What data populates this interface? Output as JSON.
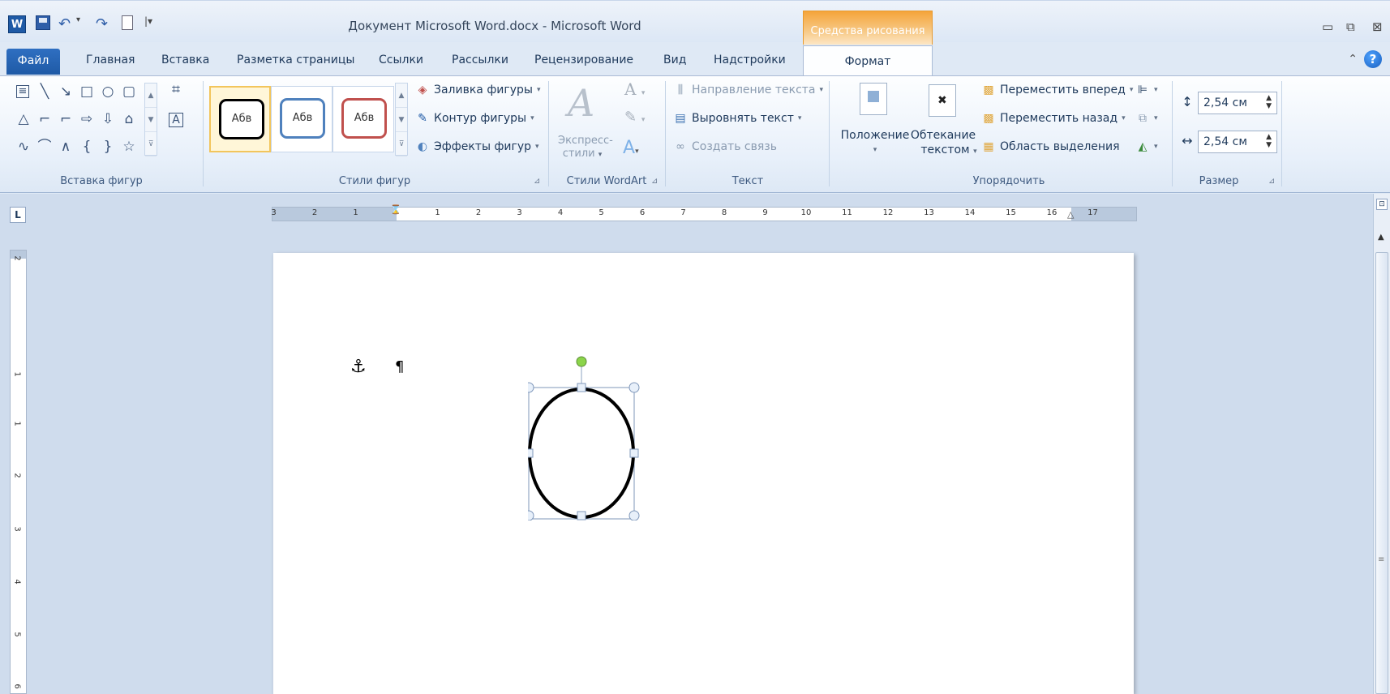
{
  "titlebar": {
    "title": "Документ Microsoft Word.docx - Microsoft Word",
    "contextual_tab": "Средства рисования",
    "qat": [
      "word-icon",
      "save-icon",
      "undo-icon",
      "redo-icon",
      "new-document-icon",
      "customize-qat-icon"
    ]
  },
  "tabs": {
    "file": "Файл",
    "items": [
      "Главная",
      "Вставка",
      "Разметка страницы",
      "Ссылки",
      "Рассылки",
      "Рецензирование",
      "Вид",
      "Надстройки"
    ],
    "active": "Формат"
  },
  "ribbon": {
    "insert_shapes": {
      "label": "Вставка фигур"
    },
    "shape_styles": {
      "label": "Стили фигур",
      "preset_label": "Абв",
      "presets": [
        "#000000",
        "#4f81bd",
        "#c0504d"
      ],
      "fill": "Заливка фигуры",
      "outline": "Контур фигуры",
      "effects": "Эффекты фигур"
    },
    "wordart": {
      "label": "Стили WordArt",
      "express_line1": "Экспресс-",
      "express_line2": "стили"
    },
    "text": {
      "label": "Текст",
      "direction": "Направление текста",
      "align": "Выровнять текст",
      "link": "Создать связь"
    },
    "arrange": {
      "label": "Упорядочить",
      "position": "Положение",
      "wrap_line1": "Обтекание",
      "wrap_line2": "текстом",
      "forward": "Переместить вперед",
      "backward": "Переместить назад",
      "selection": "Область выделения"
    },
    "size": {
      "label": "Размер",
      "height": "2,54 см",
      "width": "2,54 см"
    }
  },
  "ruler": {
    "h_left": [
      "3",
      "2",
      "1"
    ],
    "h_right": [
      "1",
      "2",
      "3",
      "4",
      "5",
      "6",
      "7",
      "8",
      "9",
      "10",
      "11",
      "12",
      "13",
      "14",
      "15",
      "16",
      "17"
    ],
    "v": [
      "2",
      "1",
      "1",
      "2",
      "3",
      "4",
      "5",
      "6"
    ],
    "tab_selector": "L"
  },
  "document": {
    "anchor": "⚓",
    "pilcrow": "¶",
    "shape": "oval"
  },
  "colors": {
    "accent": "#1f5aa6",
    "contextual": "#f5a43a",
    "handle_rotate": "#8bd44a"
  }
}
